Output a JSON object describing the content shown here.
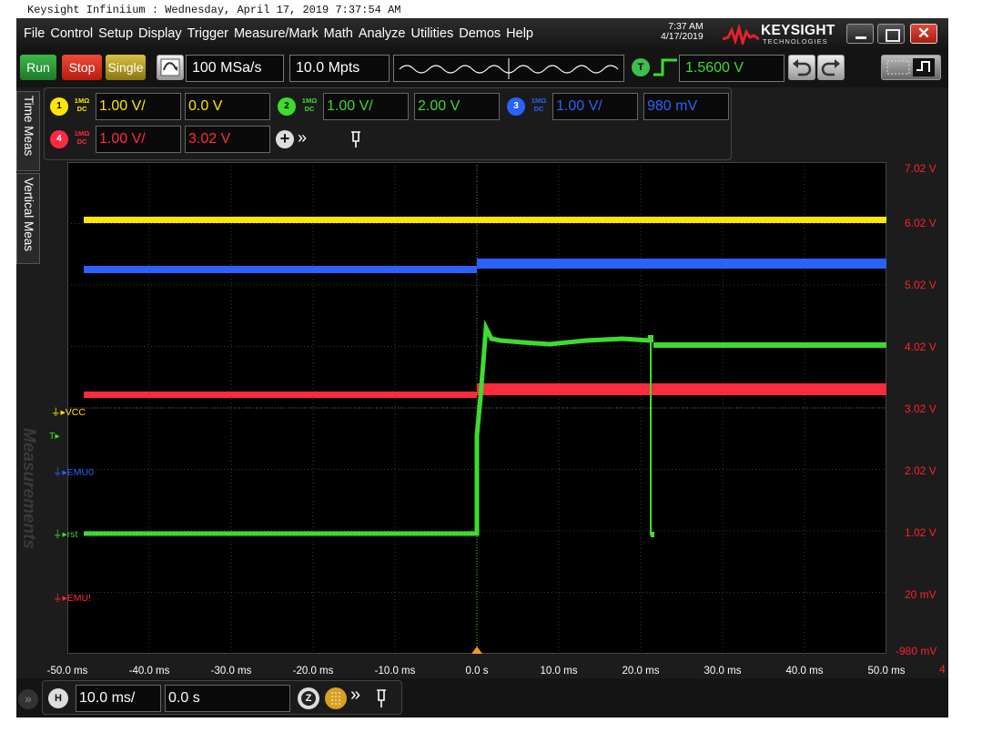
{
  "window_caption": "Keysight Infiniium : Wednesday, April 17, 2019 7:37:54 AM",
  "menu": [
    "File",
    "Control",
    "Setup",
    "Display",
    "Trigger",
    "Measure/Mark",
    "Math",
    "Analyze",
    "Utilities",
    "Demos",
    "Help"
  ],
  "clock": {
    "time": "7:37 AM",
    "date": "4/17/2019"
  },
  "logo": {
    "name": "KEYSIGHT",
    "sub": "TECHNOLOGIES"
  },
  "toolbar": {
    "run": "Run",
    "stop": "Stop",
    "single": "Single",
    "sample_rate": "100 MSa/s",
    "memory_depth": "10.0 Mpts",
    "trigger_badge": "T",
    "trigger_level": "1.5600 V"
  },
  "channels": [
    {
      "num": "1",
      "impedance": "1MΩ",
      "coupling": "DC",
      "scale": "1.00 V/",
      "offset": "0.0 V",
      "color": "#ffe600"
    },
    {
      "num": "2",
      "impedance": "1MΩ",
      "coupling": "DC",
      "scale": "1.00 V/",
      "offset": "2.00 V",
      "color": "#3ddc2e"
    },
    {
      "num": "3",
      "impedance": "1MΩ",
      "coupling": "DC",
      "scale": "1.00 V/",
      "offset": "980 mV",
      "color": "#2a62ff"
    },
    {
      "num": "4",
      "impedance": "1MΩ",
      "coupling": "DC",
      "scale": "1.00 V/",
      "offset": "3.02 V",
      "color": "#ff2a3d"
    }
  ],
  "side_tabs": [
    "Time Meas",
    "Vertical Meas"
  ],
  "measurements_watermark": "Measurements",
  "waveform_labels": [
    {
      "text": "VCC",
      "color": "#ffe600"
    },
    {
      "text": "T",
      "color": "#3ddc2e"
    },
    {
      "text": "EMU0",
      "color": "#2a62ff"
    },
    {
      "text": "rst",
      "color": "#3ddc2e"
    },
    {
      "text": "EMU!",
      "color": "#ff2a3d"
    }
  ],
  "right_axis": [
    "7.02 V",
    "6.02 V",
    "5.02 V",
    "4.02 V",
    "3.02 V",
    "2.02 V",
    "1.02 V",
    "20 mV",
    "-980 mV"
  ],
  "right_axis_ref": "4",
  "x_axis": [
    "-50.0 ms",
    "-40.0 ms",
    "-30.0 ms",
    "-20.0 ms",
    "-10.0 ms",
    "0.0 s",
    "10.0 ms",
    "20.0 ms",
    "30.0 ms",
    "40.0 ms",
    "50.0 ms"
  ],
  "horizontal": {
    "badge": "H",
    "scale": "10.0 ms/",
    "position": "0.0 s"
  },
  "colors": {
    "ch1": "#ffe600",
    "ch2": "#3ddc2e",
    "ch3": "#2a62ff",
    "ch4": "#ff2a3d",
    "axis_red": "#ff2030"
  }
}
